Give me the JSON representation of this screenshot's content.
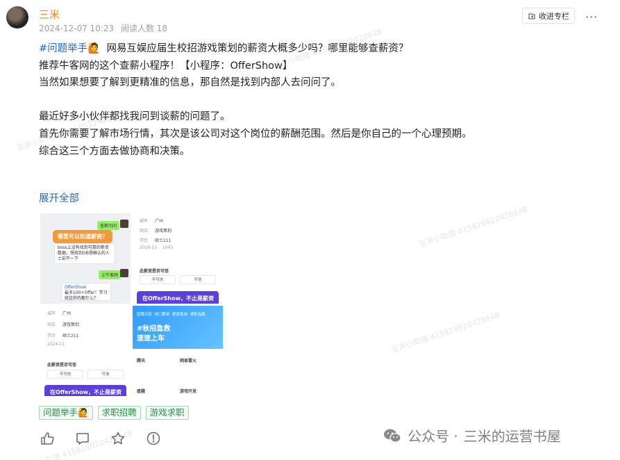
{
  "post": {
    "author": "三米",
    "date": "2024-12-07 10:23",
    "read_count": "阅读人数 18",
    "collect_label": "收进专栏",
    "more_label": "···"
  },
  "content": {
    "topic": "#问题举手🙋",
    "lines": [
      "网易互娱应届生校招游戏策划的薪资大概多少吗？哪里能够查薪资？",
      "推荐牛客网的这个查薪小程序！【小程序：OfferShow】",
      "当然如果想要了解到更精准的信息，那自然是找到内部人去问问了。",
      "最近好多小伙伴都找我问到谈薪的问题了。",
      "首先你需要了解市场行情，其次是该公司对这个岗位的薪酬范围。然后是你自己的一个心理预期。",
      "综合这三个方面去做协商和决策。"
    ],
    "expand_label": "展开全部"
  },
  "images": {
    "img1": {
      "top_bubble": "查薪问问",
      "question": "哪里可以知道薪资？",
      "grey_text": "boss上没有找到可靠的薪资数据，想找到OB想确认的人士却不一下",
      "reply": "上牛客网",
      "card_title": "OfferShow",
      "card_text": "最多100+Offer！学习就这样的都什么？"
    },
    "img2": {
      "city_label": "城市",
      "city": "广州",
      "job_label": "岗位",
      "job": "游戏策划",
      "edu_label": "学历",
      "edu": "硕士211",
      "date": "2024-11",
      "views": "1043",
      "question": "此薪资是否可信",
      "btn_no": "不可信",
      "btn_yes": "可信",
      "banner": "在OfferShow，不止是薪资"
    },
    "img3": {
      "city_label": "城市",
      "city": "广州",
      "job_label": "岗位",
      "job": "游戏策划",
      "edu_label": "学历",
      "edu": "硕士211",
      "date": "2024-11",
      "question": "此薪资是否可信",
      "btn_no": "不可信",
      "btn_yes": "可信",
      "banner": "在OfferShow，不止是薪资"
    },
    "img4": {
      "tabs": [
        "招聘日历",
        "热门薪资",
        "薪资查询",
        "求职指南"
      ],
      "headline": "#秋招急救",
      "subline": "速速上车",
      "row_left": "腾讯",
      "row_right": "网易雷火",
      "bottom_left": "盛趣",
      "bottom_right": "游戏开发"
    }
  },
  "tags": [
    "问题举手🙋",
    "求职招聘",
    "游戏求职"
  ],
  "watermark": {
    "prefix": "公众号 · ",
    "name": "三米的运营书屋",
    "repeat_text": "豆米小助理 415818822428848"
  },
  "colors": {
    "author": "#f08a24",
    "link": "#2e67b1",
    "tag_text": "#2a8a4a",
    "tag_border": "#9fd9b0",
    "banner_purple": "#5b3fd8"
  },
  "icons": {
    "actions": [
      "thumbs-up-icon",
      "comment-icon",
      "star-icon",
      "reward-icon"
    ]
  }
}
